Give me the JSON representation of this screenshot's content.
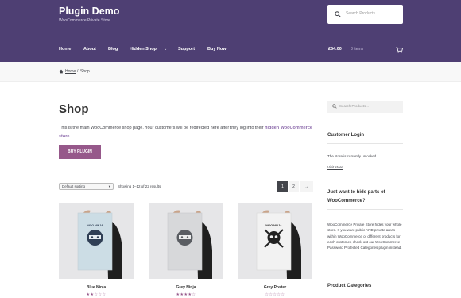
{
  "header": {
    "site_title": "Plugin Demo",
    "site_description": "WooCommerce Private Store",
    "search_placeholder": "Search Products ...",
    "nav": [
      {
        "label": "Home"
      },
      {
        "label": "About"
      },
      {
        "label": "Blog"
      },
      {
        "label": "Hidden Shop"
      },
      {
        "label": "Support"
      },
      {
        "label": "Buy Now"
      }
    ],
    "cart_amount": "£54.00",
    "cart_items": "3 items"
  },
  "breadcrumb": {
    "home": "Home",
    "separator": "/",
    "current": "Shop"
  },
  "main": {
    "page_title": "Shop",
    "intro_text": "This is the main WooCommerce shop page. Your customers will be redirected here after they log into their",
    "intro_link": "hidden WooCommerce store.",
    "buy_button": "BUY PLUGIN",
    "sorting_value": "Default sorting",
    "result_count": "Showing 1–12 of 22 results",
    "pagination": [
      "1",
      "2",
      "→"
    ],
    "products": [
      {
        "title": "Blue Ninja",
        "rating": "★★☆☆☆",
        "poster_text": "WOO NINJA"
      },
      {
        "title": "Grey Ninja",
        "rating": "★★★★☆",
        "poster_text": ""
      },
      {
        "title": "Grey Poster",
        "rating": "☆☆☆☆☆",
        "poster_text": "WOO NINJA"
      }
    ]
  },
  "sidebar": {
    "search_placeholder": "Search Products...",
    "customer_login_title": "Customer Login",
    "login_status": "The store is currently unlocked.",
    "logout_link": "Visit store",
    "hide_title": "Just want to hide parts of WooCommerce?",
    "hide_text": "WooCommerce Private Store hides your whole store. If you want public AND private areas within WooCommerce or different products for each customer, check out our WooCommerce Password Protected Categories plugin instead.",
    "categories_title": "Product Categories"
  },
  "colors": {
    "header_bg": "#4e3f73",
    "button": "#96588a",
    "link": "#8c6aab"
  }
}
